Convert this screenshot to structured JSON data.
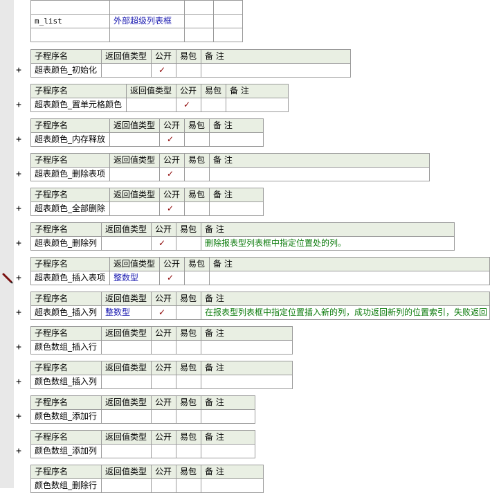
{
  "var_table": {
    "rows": [
      [
        "",
        "",
        "",
        ""
      ],
      [
        "m_list",
        "外部超级列表框",
        "",
        ""
      ],
      [
        "",
        "",
        "",
        ""
      ]
    ]
  },
  "headers": {
    "name": "子程序名",
    "return_type": "返回值类型",
    "public": "公开",
    "easy_pack": "易包",
    "note": "备 注"
  },
  "plus_symbol": "+",
  "check_symbol": "✓",
  "subs": [
    {
      "name": "超表颜色_初始化",
      "return_type": "",
      "public": true,
      "note": ""
    },
    {
      "name": "超表颜色_置单元格颜色",
      "return_type": "",
      "public": true,
      "note": ""
    },
    {
      "name": "超表颜色_内存释放",
      "return_type": "",
      "public": true,
      "note": ""
    },
    {
      "name": "超表颜色_删除表项",
      "return_type": "",
      "public": true,
      "note": ""
    },
    {
      "name": "超表颜色_全部删除",
      "return_type": "",
      "public": true,
      "note": ""
    },
    {
      "name": "超表颜色_删除列",
      "return_type": "",
      "public": true,
      "note": "删除报表型列表框中指定位置处的列。"
    },
    {
      "name": "超表颜色_插入表项",
      "return_type": "整数型",
      "public": true,
      "note": ""
    },
    {
      "name": "超表颜色_插入列",
      "return_type": "整数型",
      "public": true,
      "note": "在报表型列表框中指定位置插入新的列，成功返回新列的位置索引，失败返回"
    },
    {
      "name": "颜色数组_插入行",
      "return_type": "",
      "public": false,
      "note": ""
    },
    {
      "name": "颜色数组_插入列",
      "return_type": "",
      "public": false,
      "note": ""
    },
    {
      "name": "颜色数组_添加行",
      "return_type": "",
      "public": false,
      "note": ""
    },
    {
      "name": "颜色数组_添加列",
      "return_type": "",
      "public": false,
      "note": ""
    },
    {
      "name": "颜色数组_删除行",
      "return_type": "",
      "public": false,
      "note": ""
    }
  ],
  "colors": {
    "header_bg": "#e9efe3",
    "check": "#8b0000",
    "type_text": "#1a1ab0",
    "note_text": "#0a7a0a",
    "gutter": "#e8e8e8"
  },
  "icons": {
    "edit_marker": "pencil-icon"
  }
}
